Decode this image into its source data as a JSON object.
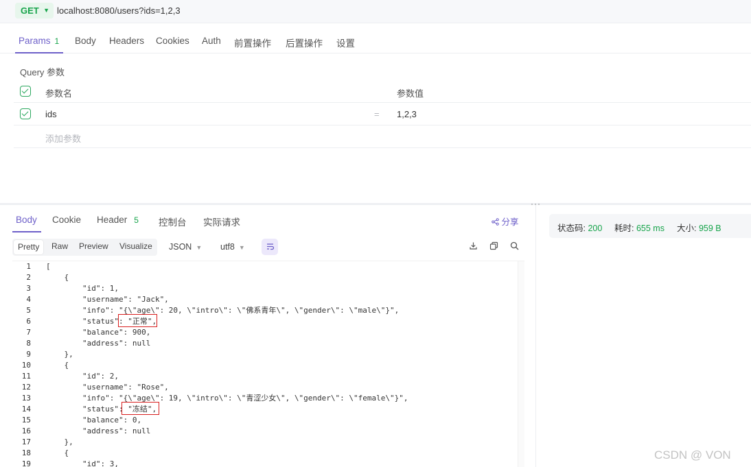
{
  "request": {
    "method": "GET",
    "url": "localhost:8080/users?ids=1,2,3"
  },
  "request_tabs": [
    {
      "label": "Params",
      "count": "1"
    },
    {
      "label": "Body"
    },
    {
      "label": "Headers"
    },
    {
      "label": "Cookies"
    },
    {
      "label": "Auth"
    },
    {
      "label": "前置操作"
    },
    {
      "label": "后置操作"
    },
    {
      "label": "设置"
    }
  ],
  "query": {
    "title": "Query 参数",
    "col_name": "参数名",
    "col_value": "参数值",
    "params": [
      {
        "name": "ids",
        "eq": "=",
        "value": "1,2,3"
      }
    ],
    "add_placeholder": "添加参数"
  },
  "split_handle": "···",
  "response_tabs": [
    {
      "label": "Body"
    },
    {
      "label": "Cookie"
    },
    {
      "label": "Header",
      "count": "5"
    },
    {
      "label": "控制台"
    },
    {
      "label": "实际请求"
    }
  ],
  "share_label": "分享",
  "format_tabs": [
    "Pretty",
    "Raw",
    "Preview",
    "Visualize"
  ],
  "format_select": "JSON",
  "encoding_select": "utf8",
  "code_lines": [
    "[",
    "    {",
    "        \"id\": 1,",
    "        \"username\": \"Jack\",",
    "        \"info\": \"{\\\"age\\\": 20, \\\"intro\\\": \\\"佛系青年\\\", \\\"gender\\\": \\\"male\\\"}\",",
    "        \"status\": \"正常\",",
    "        \"balance\": 900,",
    "        \"address\": null",
    "    },",
    "    {",
    "        \"id\": 2,",
    "        \"username\": \"Rose\",",
    "        \"info\": \"{\\\"age\\\": 19, \\\"intro\\\": \\\"青涩少女\\\", \\\"gender\\\": \\\"female\\\"}\",",
    "        \"status\": \"冻结\",",
    "        \"balance\": 0,",
    "        \"address\": null",
    "    },",
    "    {",
    "        \"id\": 3,"
  ],
  "status": {
    "code_label": "状态码:",
    "code": "200",
    "time_label": "耗时:",
    "time": "655 ms",
    "size_label": "大小:",
    "size": "959 B"
  },
  "watermark": "CSDN @ VON",
  "colors": {
    "accent": "#6d5fc9",
    "success": "#16a34a",
    "highlight_box": "#d81e1e"
  }
}
